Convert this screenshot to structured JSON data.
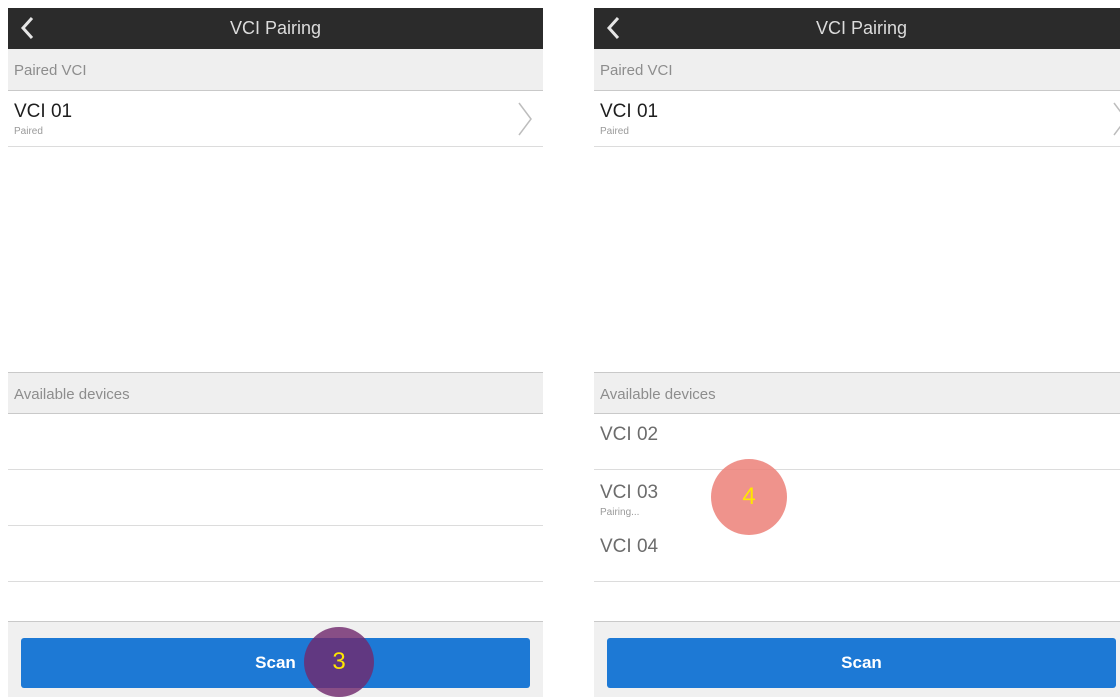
{
  "app": {
    "title": "VCI Pairing"
  },
  "left_screen": {
    "paired_header": "Paired VCI",
    "paired_device": {
      "name": "VCI 01",
      "status": "Paired"
    },
    "available_header": "Available devices",
    "available_devices": [
      {
        "name": "",
        "status": ""
      },
      {
        "name": "",
        "status": ""
      },
      {
        "name": "",
        "status": ""
      }
    ],
    "scan_label": "Scan",
    "step_marker": "3"
  },
  "right_screen": {
    "paired_header": "Paired VCI",
    "paired_device": {
      "name": "VCI 01",
      "status": "Paired"
    },
    "available_header": "Available devices",
    "available_devices": [
      {
        "name": "VCI 02",
        "status": ""
      },
      {
        "name": "VCI 03",
        "status": "Pairing..."
      },
      {
        "name": "VCI 04",
        "status": ""
      }
    ],
    "scan_label": "Scan",
    "step_marker": "4"
  },
  "icons": {
    "back": "chevron-left-icon",
    "row_arrow": "chevron-right-icon"
  },
  "colors": {
    "title_bar": "#2b2b2b",
    "scan_button": "#1d79d5",
    "section_header": "#efefef",
    "marker_3": "#702a6e",
    "marker_4": "#ec8078",
    "marker_text": "#ffe600"
  }
}
